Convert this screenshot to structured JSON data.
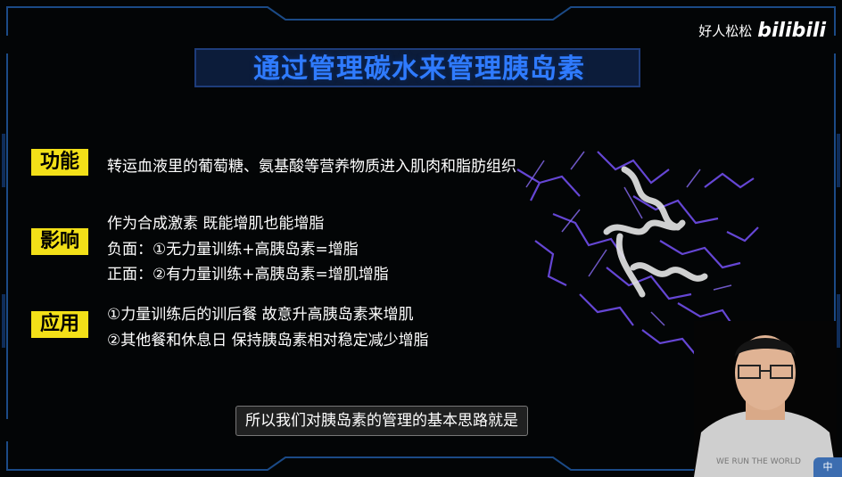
{
  "slide": {
    "title": "通过管理碳水来管理胰岛素",
    "sections": [
      {
        "tag": "功能",
        "lines": [
          "转运血液里的葡萄糖、氨基酸等营养物质进入肌肉和脂肪组织"
        ]
      },
      {
        "tag": "影响",
        "lines": [
          "作为合成激素 既能增肌也能增脂",
          "负面：①无力量训练+高胰岛素=增脂",
          "正面：②有力量训练+高胰岛素=增肌增脂"
        ]
      },
      {
        "tag": "应用",
        "lines": [
          "①力量训练后的训后餐 故意升高胰岛素来增肌",
          "②其他餐和休息日 保持胰岛素相对稳定减少增脂"
        ]
      }
    ]
  },
  "watermark": {
    "uploader": "好人松松",
    "logo": "bilibili"
  },
  "subtitle": "所以我们对胰岛素的管理的基本思路就是",
  "presenter": {
    "shirt_text": "WE RUN THE WORLD"
  },
  "colors": {
    "title": "#2f7bff",
    "tag_bg": "#f3e018",
    "hud": "#1b4a86"
  }
}
